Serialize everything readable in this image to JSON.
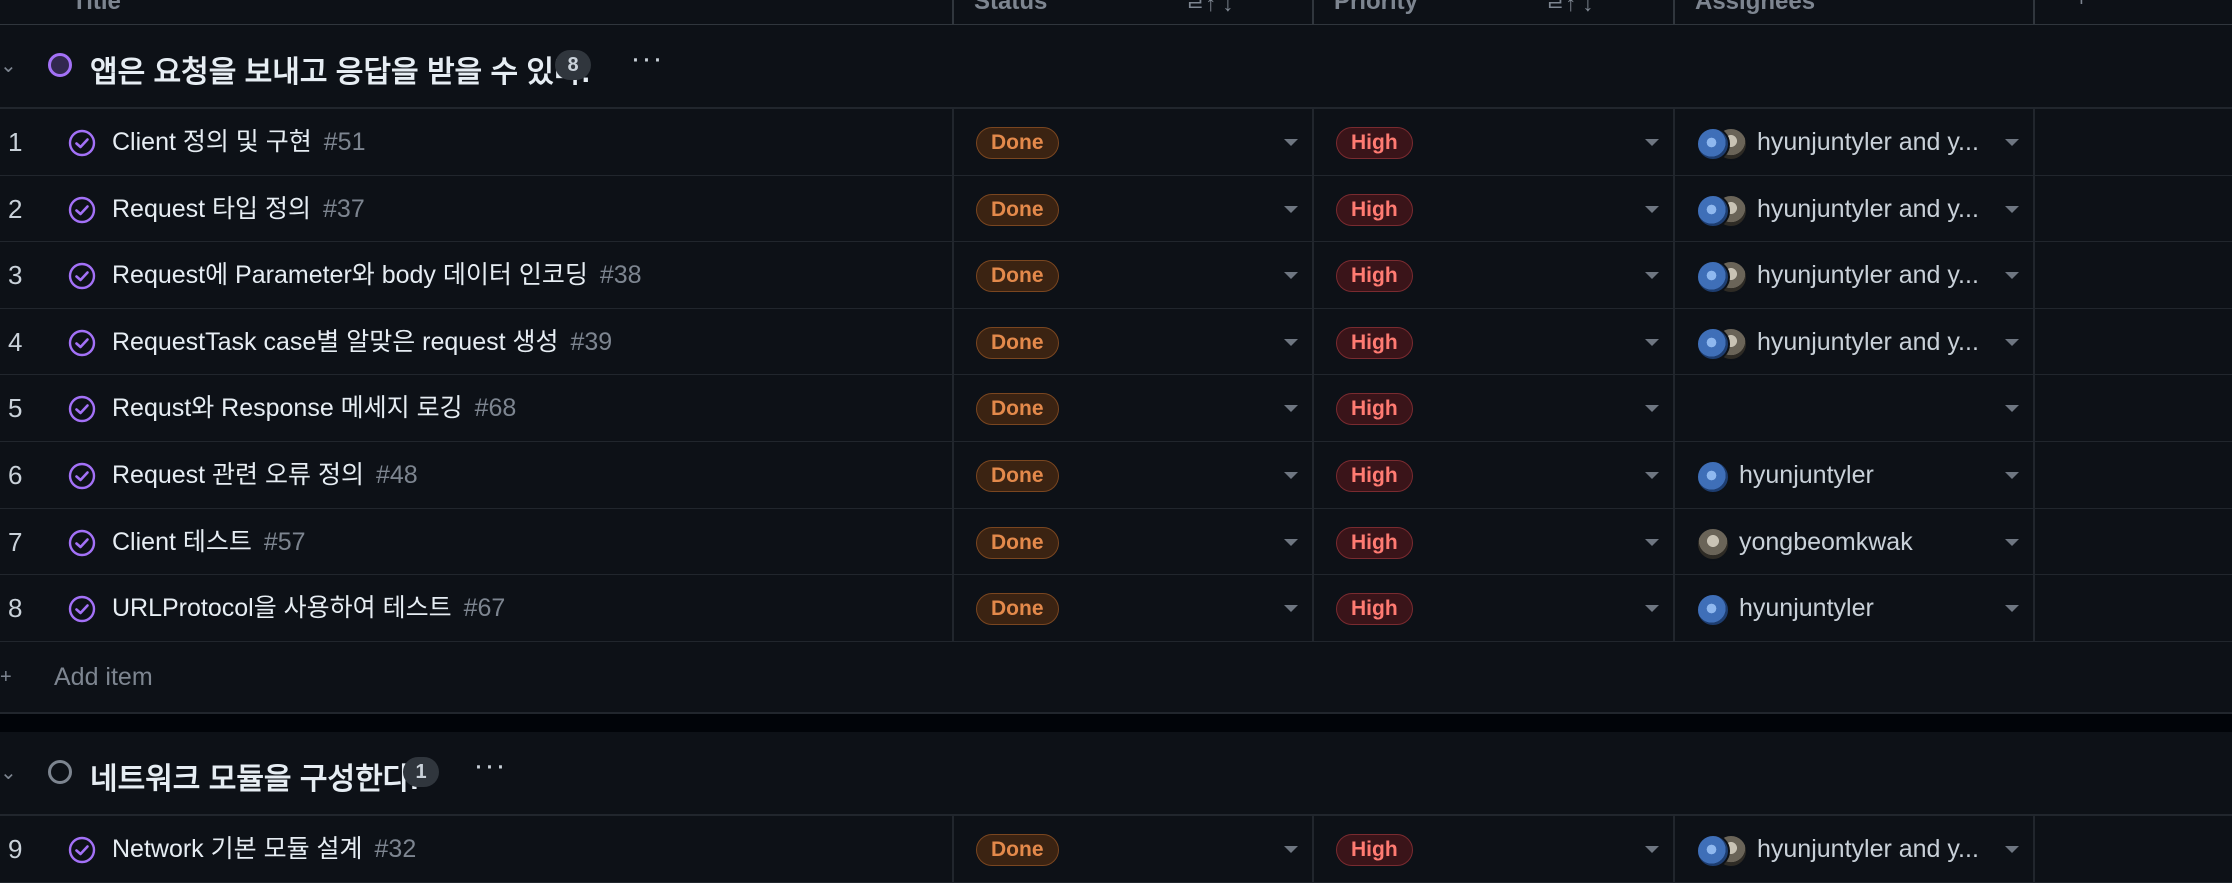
{
  "header": {
    "columns": [
      {
        "label": "Title",
        "extra": ""
      },
      {
        "label": "Status",
        "extra": "ㄹ↑ ↓"
      },
      {
        "label": "Priority",
        "extra": "ㄹ↑ ↓"
      },
      {
        "label": "Assignees",
        "extra": ""
      },
      {
        "label": "",
        "extra": "+"
      }
    ]
  },
  "groups": [
    {
      "title": "앱은 요청을 보내고 응답을 받을 수 있다.",
      "count": "8",
      "status_color": "#a371f7",
      "menu": "···",
      "add_item_label": "Add item",
      "rows": [
        {
          "num": "1",
          "title": "Client 정의 및 구현",
          "issue": "#51",
          "status": "Done",
          "priority": "High",
          "assignees": "hyunjuntyler and y...",
          "avatars": [
            "h",
            "y"
          ]
        },
        {
          "num": "2",
          "title": "Request 타입 정의",
          "issue": "#37",
          "status": "Done",
          "priority": "High",
          "assignees": "hyunjuntyler and y...",
          "avatars": [
            "h",
            "y"
          ]
        },
        {
          "num": "3",
          "title": "Request에 Parameter와 body 데이터 인코딩",
          "issue": "#38",
          "status": "Done",
          "priority": "High",
          "assignees": "hyunjuntyler and y...",
          "avatars": [
            "h",
            "y"
          ]
        },
        {
          "num": "4",
          "title": "RequestTask case별 알맞은 request 생성",
          "issue": "#39",
          "status": "Done",
          "priority": "High",
          "assignees": "hyunjuntyler and y...",
          "avatars": [
            "h",
            "y"
          ]
        },
        {
          "num": "5",
          "title": "Requst와 Response 메세지 로깅",
          "issue": "#68",
          "status": "Done",
          "priority": "High",
          "assignees": "",
          "avatars": []
        },
        {
          "num": "6",
          "title": "Request 관련 오류 정의",
          "issue": "#48",
          "status": "Done",
          "priority": "High",
          "assignees": "hyunjuntyler",
          "avatars": [
            "h"
          ]
        },
        {
          "num": "7",
          "title": "Client 테스트",
          "issue": "#57",
          "status": "Done",
          "priority": "High",
          "assignees": "yongbeomkwak",
          "avatars": [
            "y"
          ]
        },
        {
          "num": "8",
          "title": "URLProtocol을 사용하여 테스트",
          "issue": "#67",
          "status": "Done",
          "priority": "High",
          "assignees": "hyunjuntyler",
          "avatars": [
            "h"
          ]
        }
      ]
    },
    {
      "title": "네트워크 모듈을 구성한다.",
      "count": "1",
      "status_color": "#7d8590",
      "menu": "···",
      "add_item_label": "",
      "rows": [
        {
          "num": "9",
          "title": "Network 기본 모듈 설계",
          "issue": "#32",
          "status": "Done",
          "priority": "High",
          "assignees": "hyunjuntyler and y...",
          "avatars": [
            "h",
            "y"
          ]
        }
      ]
    }
  ]
}
